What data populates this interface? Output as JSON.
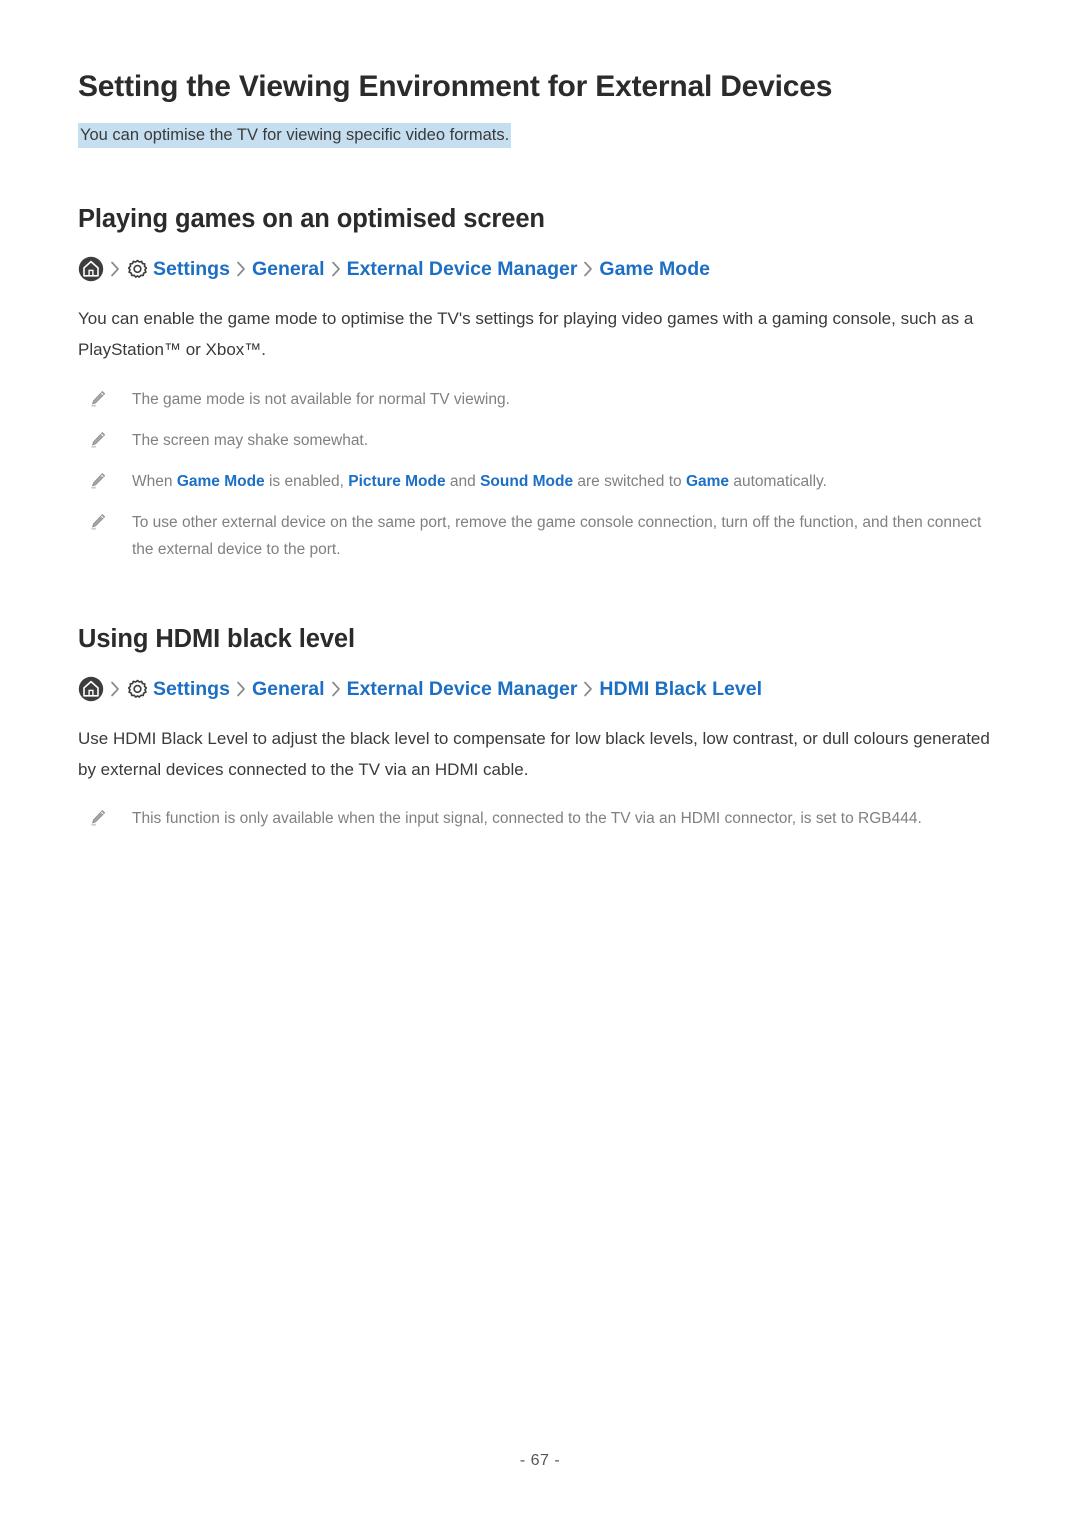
{
  "document": {
    "title": "Setting the Viewing Environment for External Devices",
    "subtitle": "You can optimise the TV for viewing specific video formats.",
    "page_number": "- 67 -"
  },
  "sections": [
    {
      "heading": "Playing games on an optimised screen",
      "breadcrumb": {
        "home_icon": "home-icon",
        "gear_icon": "gear-icon",
        "separator_icon": "chevron-right-icon",
        "items": [
          {
            "label": "Settings"
          },
          {
            "label": "General"
          },
          {
            "label": "External Device Manager"
          },
          {
            "label": "Game Mode"
          }
        ]
      },
      "body": "You can enable the game mode to optimise the TV's settings for playing video games with a gaming console, such as a PlayStation™ or Xbox™.",
      "notes": [
        {
          "text": "The game mode is not available for normal TV viewing."
        },
        {
          "text": "The screen may shake somewhat."
        },
        {
          "parts": [
            {
              "text": "When ",
              "style": "plain"
            },
            {
              "text": "Game Mode",
              "style": "keyword"
            },
            {
              "text": " is enabled, ",
              "style": "plain"
            },
            {
              "text": "Picture Mode",
              "style": "keyword"
            },
            {
              "text": " and ",
              "style": "plain"
            },
            {
              "text": "Sound Mode",
              "style": "keyword"
            },
            {
              "text": " are switched to ",
              "style": "plain"
            },
            {
              "text": "Game",
              "style": "keyword"
            },
            {
              "text": " automatically.",
              "style": "plain"
            }
          ]
        },
        {
          "text": "To use other external device on the same port, remove the game console connection, turn off the function, and then connect the external device to the port."
        }
      ]
    },
    {
      "heading": "Using HDMI black level",
      "breadcrumb": {
        "home_icon": "home-icon",
        "gear_icon": "gear-icon",
        "separator_icon": "chevron-right-icon",
        "items": [
          {
            "label": "Settings"
          },
          {
            "label": "General"
          },
          {
            "label": "External Device Manager"
          },
          {
            "label": "HDMI Black Level"
          }
        ]
      },
      "body": "Use HDMI Black Level to adjust the black level to compensate for low black levels, low contrast, or dull colours generated by external devices connected to the TV via an HDMI cable.",
      "notes": [
        {
          "text": "This function is only available when the input signal, connected to the TV via an HDMI connector, is set to RGB444."
        }
      ]
    }
  ],
  "colors": {
    "link_blue": "#1c6fc4",
    "highlight": "#c5dff0",
    "body_text": "#3a3a3a",
    "note_text": "#808080",
    "heading": "#2b2b2b"
  }
}
